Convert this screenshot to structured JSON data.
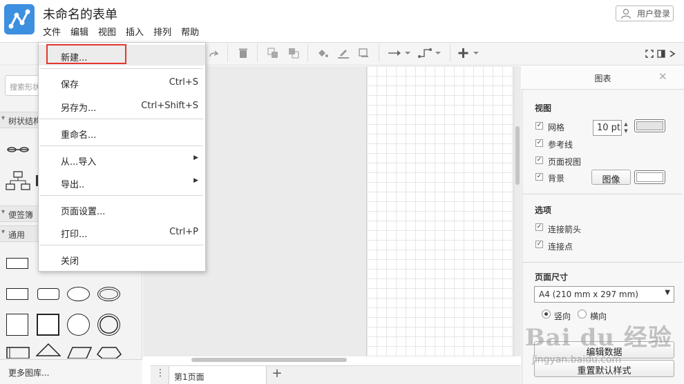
{
  "app": {
    "title": "未命名的表单",
    "login": "用户登录",
    "menu": [
      "文件",
      "编辑",
      "视图",
      "插入",
      "排列",
      "帮助"
    ]
  },
  "file_menu": {
    "items": [
      {
        "label": "新建...",
        "shortcut": ""
      },
      {
        "label": "保存",
        "shortcut": "Ctrl+S"
      },
      {
        "label": "另存为...",
        "shortcut": "Ctrl+Shift+S"
      },
      {
        "label": "重命名...",
        "shortcut": ""
      },
      {
        "label": "从...导入",
        "shortcut": ""
      },
      {
        "label": "导出..",
        "shortcut": ""
      },
      {
        "label": "页面设置...",
        "shortcut": ""
      },
      {
        "label": "打印...",
        "shortcut": "Ctrl+P"
      },
      {
        "label": "关闭",
        "shortcut": ""
      }
    ]
  },
  "left": {
    "search_placeholder": "搜索形状",
    "sections": [
      "树状结构",
      "便签簿",
      "通用"
    ],
    "more_libs": "更多图库..."
  },
  "canvas": {
    "page_tab": "第1页面"
  },
  "right": {
    "title": "图表",
    "view_heading": "视图",
    "grid": "网格",
    "grid_size": "10 pt",
    "guides": "参考线",
    "page_view": "页面视图",
    "background": "背景",
    "image_button": "图像",
    "options_heading": "选项",
    "connection_arrows": "连接箭头",
    "connection_points": "连接点",
    "page_size_heading": "页面尺寸",
    "page_size_value": "A4 (210 mm x 297 mm)",
    "portrait": "竖向",
    "landscape": "横向",
    "edit_data": "编辑数据",
    "reset_style": "重置默认样式"
  },
  "watermark": {
    "text": "Bai du 经验",
    "sub": "jingyan.baidu.com"
  },
  "colors": {
    "logo": "#3d8fe0",
    "highlight": "#e5352d"
  }
}
